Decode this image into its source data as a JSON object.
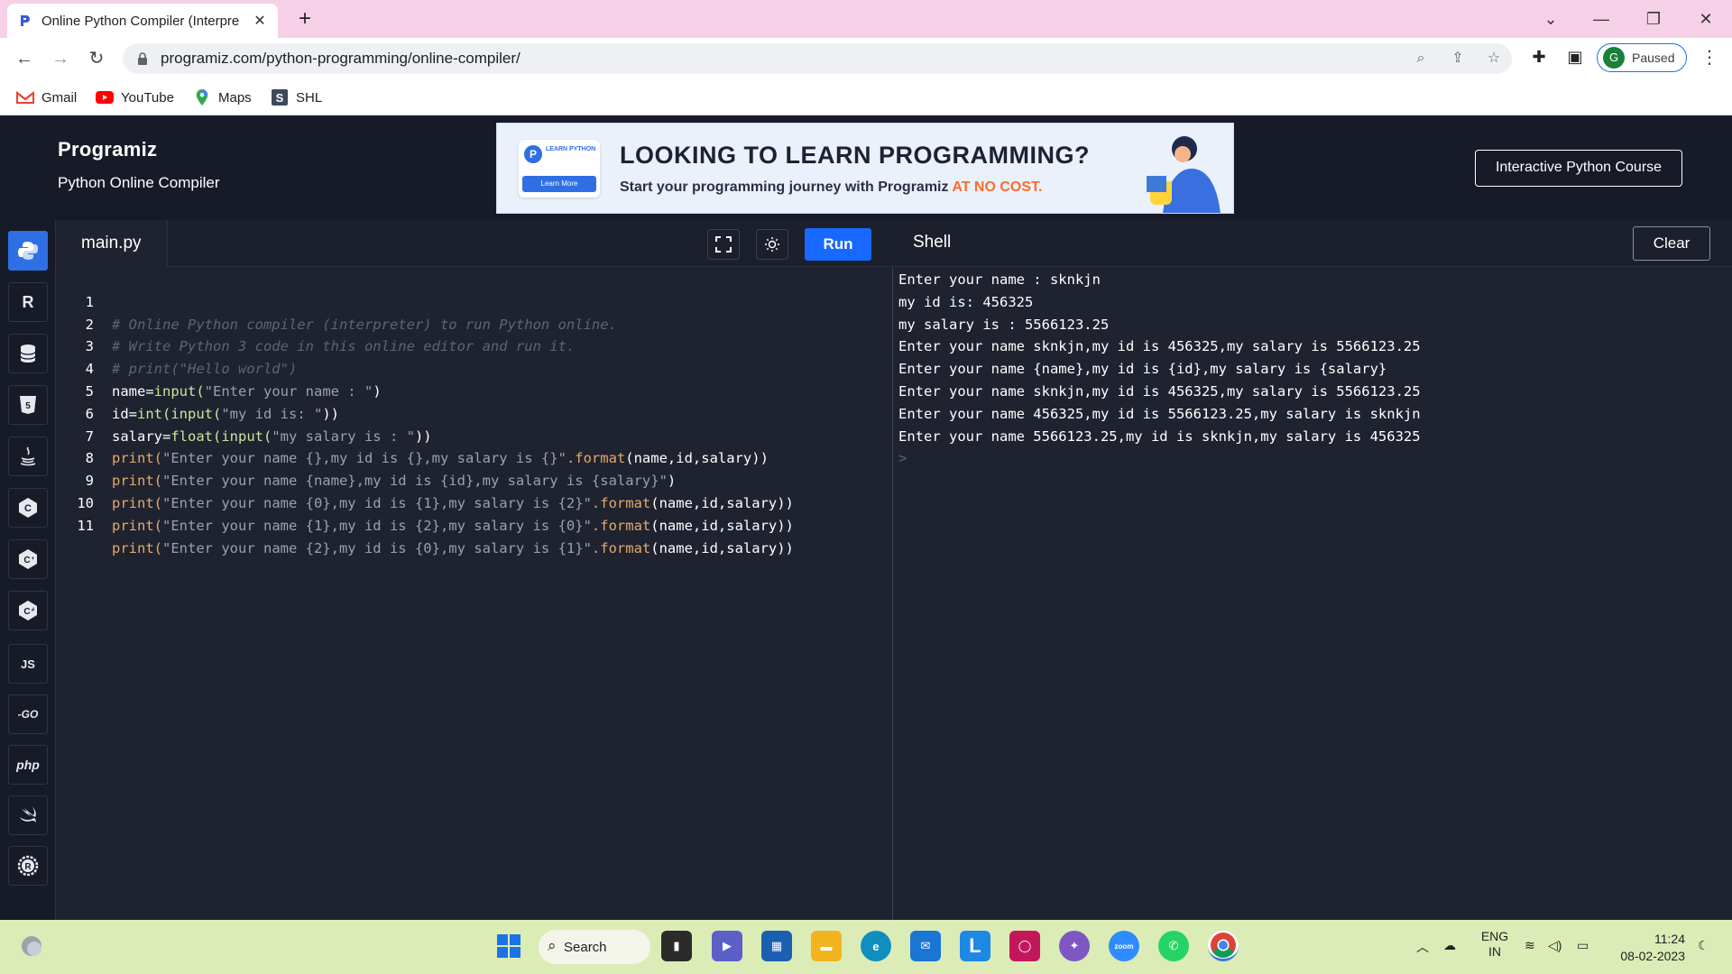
{
  "browser": {
    "tab_title": "Online Python Compiler (Interpre",
    "new_tab": "+",
    "url": "programiz.com/python-programming/online-compiler/",
    "profile_initial": "G",
    "profile_status": "Paused",
    "bookmarks": [
      {
        "label": "Gmail",
        "icon": "gmail-icon"
      },
      {
        "label": "YouTube",
        "icon": "youtube-icon"
      },
      {
        "label": "Maps",
        "icon": "maps-icon"
      },
      {
        "label": "SHL",
        "icon": "shl-icon"
      }
    ]
  },
  "header": {
    "logo": "Programiz",
    "subtitle": "Python Online Compiler",
    "course_button": "Interactive Python Course",
    "banner": {
      "card_tag": "LEARN PYTHON",
      "card_button": "Learn More",
      "headline": "LOOKING TO LEARN PROGRAMMING?",
      "subline": "Start your programming journey with Programiz ",
      "accent": "AT NO COST."
    }
  },
  "sidebar": {
    "languages": [
      {
        "name": "python",
        "label": "",
        "active": true
      },
      {
        "name": "r",
        "label": "R"
      },
      {
        "name": "sql",
        "label": ""
      },
      {
        "name": "html",
        "label": "5"
      },
      {
        "name": "java",
        "label": ""
      },
      {
        "name": "c",
        "label": "C"
      },
      {
        "name": "cpp",
        "label": "C"
      },
      {
        "name": "csharp",
        "label": "C"
      },
      {
        "name": "js",
        "label": "JS"
      },
      {
        "name": "go",
        "label": "-GO"
      },
      {
        "name": "php",
        "label": "php"
      },
      {
        "name": "swift",
        "label": ""
      },
      {
        "name": "rust",
        "label": "R"
      }
    ]
  },
  "editor": {
    "file_name": "main.py",
    "run_label": "Run",
    "line_numbers": [
      "1",
      "2",
      "3",
      "4",
      "5",
      "6",
      "7",
      "8",
      "9",
      "10",
      "11"
    ],
    "lines": {
      "l1": "# Online Python compiler (interpreter) to run Python online.",
      "l2": "# Write Python 3 code in this online editor and run it.",
      "l3": "# print(\"Hello world\")",
      "l4a": "name=",
      "l4b": "input(",
      "l4c": "\"Enter your name : \"",
      "l4d": ")",
      "l5a": "id=",
      "l5b": "int(input(",
      "l5c": "\"my id is: \"",
      "l5d": "))",
      "l6a": "salary=",
      "l6b": "float(input(",
      "l6c": "\"my salary is : \"",
      "l6d": "))",
      "l7a": "print(",
      "l7b": "\"Enter your name {},my id is {},my salary is {}\"",
      "l7c": ".format",
      "l7d": "(name,id,salary))",
      "l8a": "print(",
      "l8b": "\"Enter your name {name},my id is {id},my salary is {salary}\"",
      "l8c": ")",
      "l9a": "print(",
      "l9b": "\"Enter your name {0},my id is {1},my salary is {2}\"",
      "l9c": ".format",
      "l9d": "(name,id,salary))",
      "l10a": "print(",
      "l10b": "\"Enter your name {1},my id is {2},my salary is {0}\"",
      "l10c": ".format",
      "l10d": "(name,id,salary))",
      "l11a": "print(",
      "l11b": "\"Enter your name {2},my id is {0},my salary is {1}\"",
      "l11c": ".format",
      "l11d": "(name,id,salary))"
    }
  },
  "shell": {
    "title": "Shell",
    "clear_label": "Clear",
    "output": [
      "Enter your name : sknkjn",
      "my id is: 456325",
      "my salary is : 5566123.25",
      "Enter your name sknkjn,my id is 456325,my salary is 5566123.25",
      "Enter your name {name},my id is {id},my salary is {salary}",
      "Enter your name sknkjn,my id is 456325,my salary is 5566123.25",
      "Enter your name 456325,my id is 5566123.25,my salary is sknkjn",
      "Enter your name 5566123.25,my id is sknkjn,my salary is 456325"
    ],
    "prompt": ">"
  },
  "taskbar": {
    "search_label": "Search",
    "lang_line1": "ENG",
    "lang_line2": "IN",
    "time": "11:24",
    "date": "08-02-2023"
  },
  "colors": {
    "accent": "#1769ff",
    "editor_bg": "#1f2330",
    "header_bg": "#171b27",
    "tab_strip": "#f6d0e6",
    "taskbar": "#dcecb6"
  }
}
